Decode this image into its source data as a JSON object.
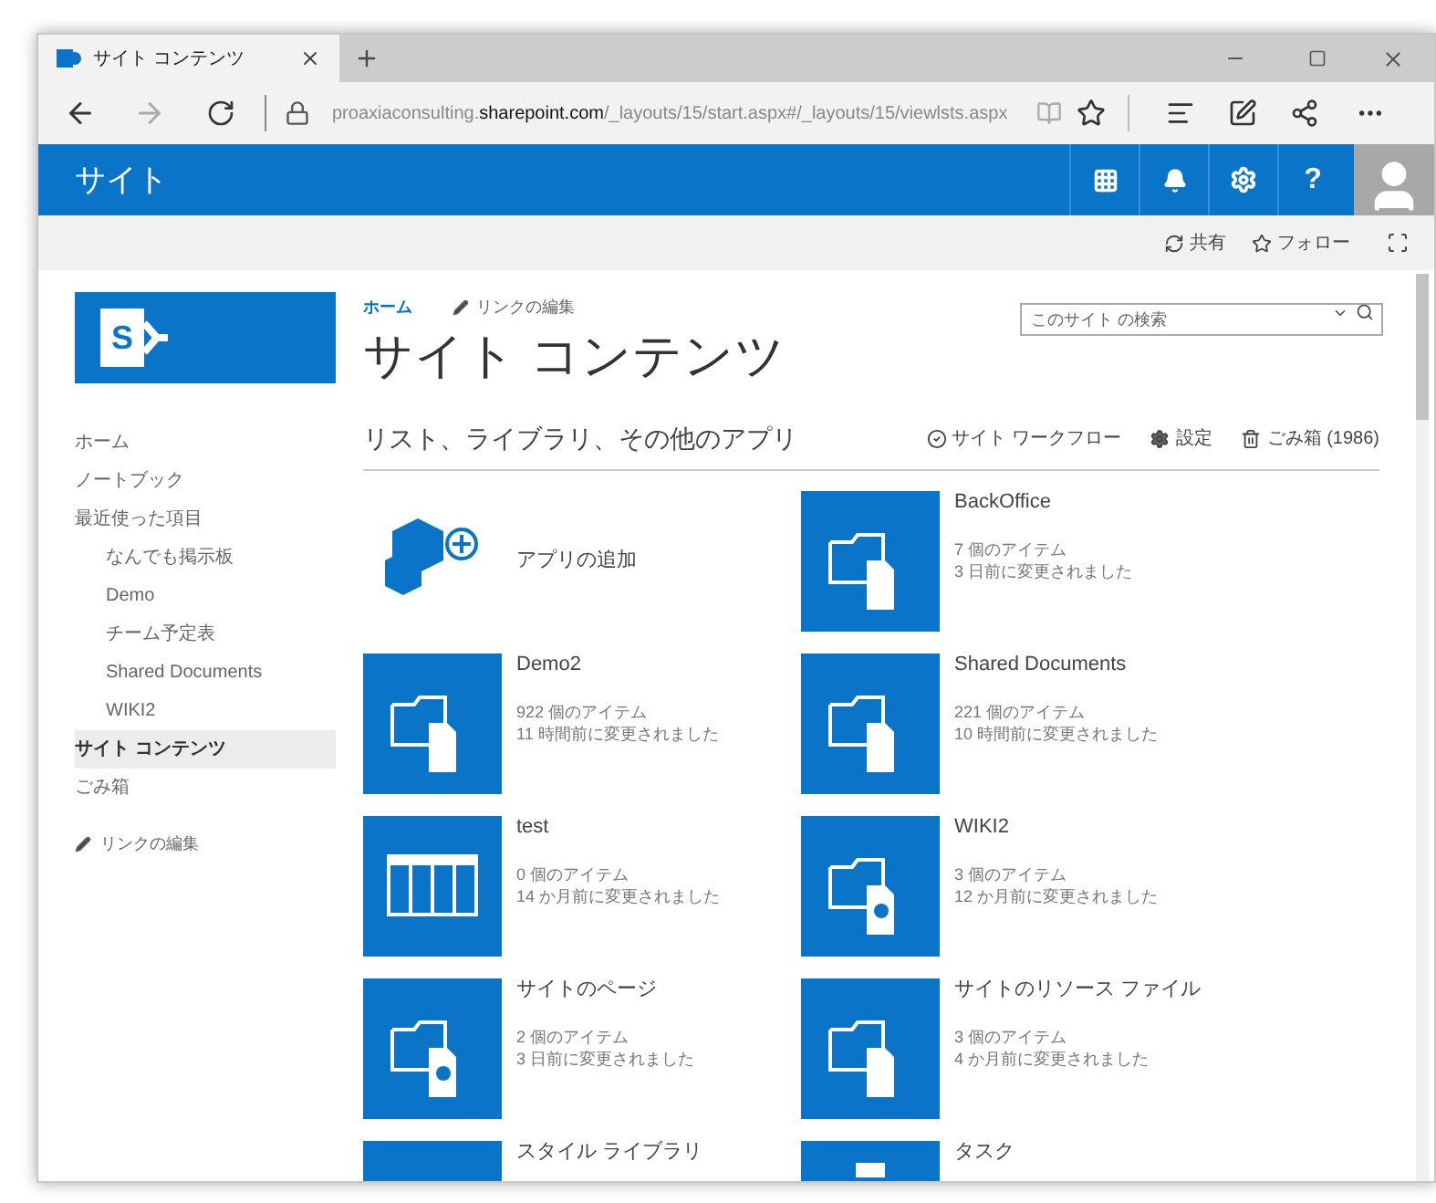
{
  "browser": {
    "tab_title": "サイト コンテンツ",
    "url_prefix": "proaxiaconsulting.",
    "url_domain": "sharepoint.com",
    "url_path": "/_layouts/15/start.aspx#/_layouts/15/viewlsts.aspx"
  },
  "suite_bar": {
    "title": "サイト",
    "help": "?"
  },
  "ribbon": {
    "share": "共有",
    "follow": "フォロー"
  },
  "logo": {
    "letter": "S"
  },
  "nav": [
    {
      "label": "ホーム",
      "selected": false
    },
    {
      "label": "ノートブック",
      "selected": false
    },
    {
      "label": "最近使った項目",
      "selected": false,
      "children": [
        {
          "label": "なんでも掲示板",
          "selected": false
        },
        {
          "label": "Demo",
          "selected": false
        },
        {
          "label": "チーム予定表",
          "selected": false
        },
        {
          "label": "Shared Documents",
          "selected": false
        },
        {
          "label": "WIKI2",
          "selected": false
        }
      ]
    },
    {
      "label": "サイト コンテンツ",
      "selected": true
    },
    {
      "label": "ごみ箱",
      "selected": false
    }
  ],
  "nav_edit_links": "リンクの編集",
  "breadcrumb": {
    "home": "ホーム",
    "edit_links": "リンクの編集"
  },
  "search": {
    "placeholder": "このサイト の検索"
  },
  "page_title": "サイト コンテンツ",
  "section": {
    "title": "リスト、ライブラリ、その他のアプリ",
    "workflow": "サイト ワークフロー",
    "settings": "設定",
    "recycle": "ごみ箱 (1986)"
  },
  "add_app": {
    "kind": "add",
    "name": "アプリの追加"
  },
  "tiles": [
    {
      "kind": "library",
      "name": "BackOffice",
      "items": "7 個のアイテム",
      "modified": "3 日前に変更されました"
    },
    {
      "kind": "library",
      "name": "Demo2",
      "items": "922 個のアイテム",
      "modified": "11 時間前に変更されました"
    },
    {
      "kind": "library",
      "name": "Shared Documents",
      "items": "221 個のアイテム",
      "modified": "10 時間前に変更されました"
    },
    {
      "kind": "list",
      "name": "test",
      "items": "0 個のアイテム",
      "modified": "14 か月前に変更されました"
    },
    {
      "kind": "wiki",
      "name": "WIKI2",
      "items": "3 個のアイテム",
      "modified": "12 か月前に変更されました"
    },
    {
      "kind": "wiki",
      "name": "サイトのページ",
      "items": "2 個のアイテム",
      "modified": "3 日前に変更されました"
    },
    {
      "kind": "library",
      "name": "サイトのリソース ファイル",
      "items": "3 個のアイテム",
      "modified": "4 か月前に変更されました"
    },
    {
      "kind": "library",
      "name": "スタイル ライブラリ"
    },
    {
      "kind": "task",
      "name": "タスク"
    }
  ]
}
